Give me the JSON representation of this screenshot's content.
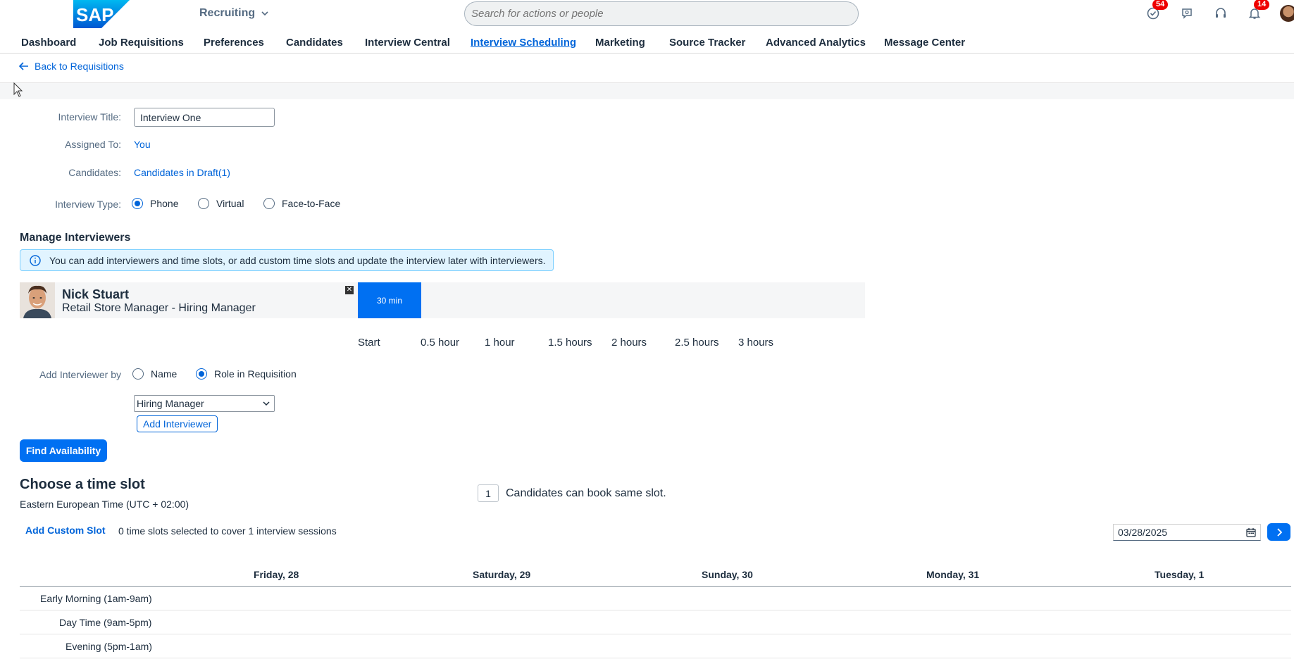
{
  "app": {
    "switcher_label": "Recruiting"
  },
  "search": {
    "placeholder": "Search for actions or people"
  },
  "shell_badges": {
    "todo": "54",
    "notifications": "14"
  },
  "nav": [
    {
      "label": "Dashboard",
      "active": false
    },
    {
      "label": "Job Requisitions",
      "active": false
    },
    {
      "label": "Preferences",
      "active": false
    },
    {
      "label": "Candidates",
      "active": false
    },
    {
      "label": "Interview Central",
      "active": false
    },
    {
      "label": "Interview Scheduling",
      "active": true
    },
    {
      "label": "Marketing",
      "active": false
    },
    {
      "label": "Source Tracker",
      "active": false
    },
    {
      "label": "Advanced Analytics",
      "active": false
    },
    {
      "label": "Message Center",
      "active": false
    }
  ],
  "back_link": "Back to Requisitions",
  "form": {
    "title_label": "Interview Title:",
    "title_value": "Interview One",
    "assigned_label": "Assigned To:",
    "assigned_value": "You",
    "candidates_label": "Candidates:",
    "candidates_value": "Candidates in Draft(1)",
    "type_label": "Interview Type:",
    "types": [
      {
        "label": "Phone",
        "selected": true
      },
      {
        "label": "Virtual",
        "selected": false
      },
      {
        "label": "Face-to-Face",
        "selected": false
      }
    ]
  },
  "manage": {
    "title": "Manage Interviewers",
    "info": "You can add interviewers and time slots, or add custom time slots and update the interview later with interviewers.",
    "interviewer": {
      "name": "Nick Stuart",
      "role": "Retail Store Manager - Hiring Manager",
      "duration": "30 min"
    },
    "timeline": [
      "Start",
      "0.5 hour",
      "1 hour",
      "1.5 hours",
      "2 hours",
      "2.5 hours",
      "3 hours"
    ],
    "add_by_label": "Add Interviewer by",
    "add_by_options": [
      {
        "label": "Name",
        "selected": false
      },
      {
        "label": "Role in Requisition",
        "selected": true
      }
    ],
    "role_select": "Hiring Manager",
    "add_button": "Add Interviewer"
  },
  "find_button": "Find Availability",
  "timeslot": {
    "title": "Choose a time slot",
    "timezone": "Eastern European Time (UTC + 02:00)",
    "candidates_count": "1",
    "candidates_label": "Candidates can book same slot.",
    "add_custom": "Add Custom Slot",
    "selected_summary": "0 time slots selected to cover 1 interview sessions",
    "date": "03/28/2025",
    "days": [
      "Friday, 28",
      "Saturday, 29",
      "Sunday, 30",
      "Monday, 31",
      "Tuesday, 1"
    ],
    "rows": [
      "Early Morning (1am-9am)",
      "Day Time (9am-5pm)",
      "Evening (5pm-1am)"
    ]
  },
  "colors": {
    "accent": "#0070f2",
    "link": "#0064d9",
    "badge": "#e00000"
  }
}
